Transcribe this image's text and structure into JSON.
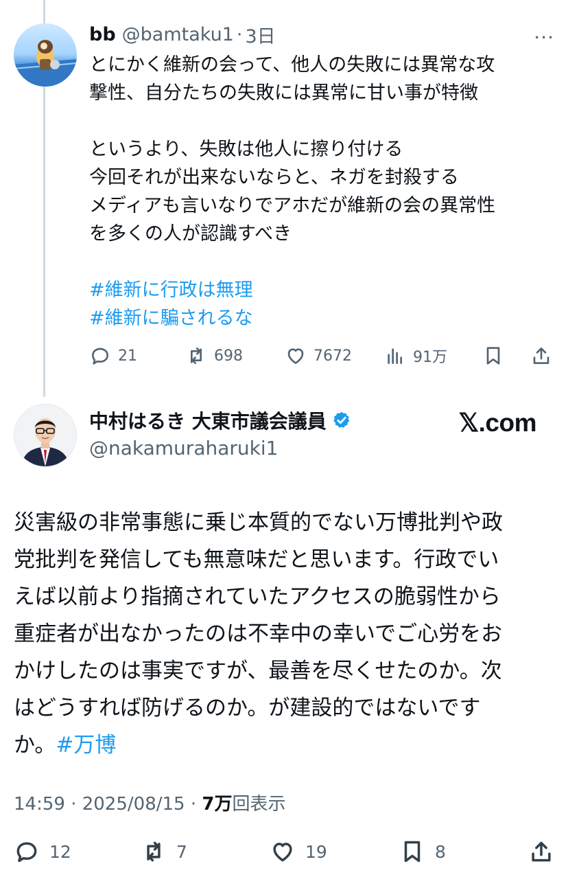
{
  "tweet1": {
    "name": "bb",
    "handle": "@bamtaku1",
    "time": "3日",
    "more_label": "···",
    "lines1": [
      "とにかく維新の会って、他人の失敗には異常な攻",
      "撃性、自分たちの失敗には異常に甘い事が特徴"
    ],
    "lines2": [
      "というより、失敗は他人に擦り付ける",
      "今回それが出来ないならと、ネガを封殺する",
      "メディアも言いなりでアホだが維新の会の異常性",
      "を多くの人が認識すべき"
    ],
    "hashtags": [
      "#維新に行政は無理",
      "#維新に騙されるな"
    ],
    "replies": "21",
    "reposts": "698",
    "likes": "7672",
    "views": "91万"
  },
  "tweet2": {
    "name": "中村はるき 大東市議会議員",
    "handle": "@nakamuraharuki1",
    "watermark": "𝕏.com",
    "body_lines": [
      "災害級の非常事態に乗じ本質的でない万博批判や政",
      "党批判を発信しても無意味だと思います。行政でい",
      "えば以前より指摘されていたアクセスの脆弱性から",
      "重症者が出なかったのは不幸中の幸いでご心労をお",
      "かけしたのは事実ですが、最善を尽くせたのか。次",
      "はどうすれば防げるのか。が建設的ではないです"
    ],
    "body_last": "か。",
    "hashtag": "#万博",
    "timestamp": "14:59 · 2025/08/15 · ",
    "views_count": "7万",
    "views_label": "回表示",
    "replies": "12",
    "reposts": "7",
    "likes": "19",
    "bookmarks": "8"
  },
  "colors": {
    "link": "#1d9bf0",
    "secondary": "#536471",
    "text": "#0f1419",
    "verified": "#1d9bf0"
  }
}
